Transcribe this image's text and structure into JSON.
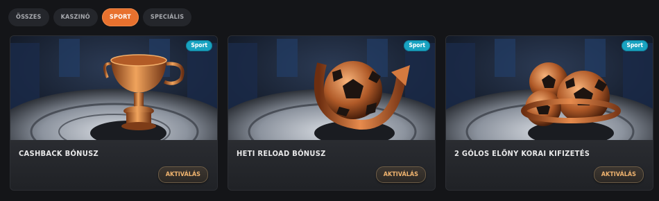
{
  "tabs": [
    {
      "label": "ÖSSZES",
      "active": false
    },
    {
      "label": "KASZINÓ",
      "active": false
    },
    {
      "label": "SPORT",
      "active": true
    },
    {
      "label": "SPECIÁLIS",
      "active": false
    }
  ],
  "cards": [
    {
      "title": "CASHBACK BÓNUSZ",
      "badge": "Sport",
      "button": "AKTIVÁLÁS",
      "image": "trophy-cup-image"
    },
    {
      "title": "HETI RELOAD BÓNUSZ",
      "badge": "Sport",
      "button": "AKTIVÁLÁS",
      "image": "football-arrow-image"
    },
    {
      "title": "2 GÓLOS ELŐNY KORAI KIFIZETÉS",
      "badge": "Sport",
      "button": "AKTIVÁLÁS",
      "image": "two-footballs-image"
    }
  ],
  "colors": {
    "accent": "#e8712e",
    "badge": "#19a3c1",
    "button_text": "#f0b46f",
    "background": "#141518"
  }
}
